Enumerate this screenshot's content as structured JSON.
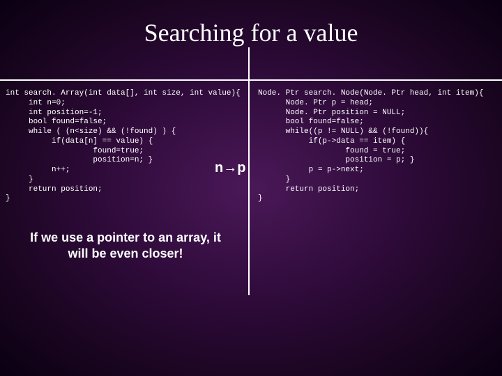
{
  "title": "Searching for a value",
  "left_code": "int search. Array(int data[], int size, int value){\n     int n=0;\n     int position=-1;\n     bool found=false;\n     while ( (n<size) && (!found) ) {\n          if(data[n] == value) {\n                   found=true;\n                   position=n; }\n          n++;\n     }\n     return position;\n}",
  "right_code": "Node. Ptr search. Node(Node. Ptr head, int item){\n      Node. Ptr p = head;\n      Node. Ptr position = NULL;\n      bool found=false;\n      while((p != NULL) && (!found)){\n           if(p->data == item) {\n                   found = true;\n                   position = p; }\n           p = p->next;\n      }\n      return position;\n}",
  "np_label_left": "n",
  "np_label_right": "p",
  "note": "If we use a pointer to an array, it will be even closer!"
}
